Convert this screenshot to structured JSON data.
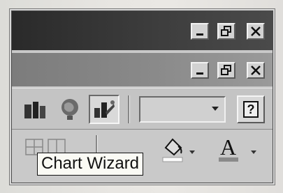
{
  "tooltip": {
    "text": "Chart Wizard"
  },
  "window_controls": {
    "outer": [
      "minimize-icon",
      "restore-icon",
      "close-icon"
    ],
    "inner": [
      "minimize-icon",
      "restore-icon",
      "close-icon"
    ]
  },
  "toolbar": {
    "buttons": [
      "chart-icon",
      "map-icon",
      "chart-wizard-icon",
      "zoom-combo",
      "help-icon"
    ],
    "zoom_value": "",
    "help_glyph": "?"
  },
  "format_toolbar": {
    "buttons": [
      "borders-icon",
      "fill-color-icon",
      "font-color-icon"
    ],
    "font_color_glyph": "A"
  },
  "colors": {
    "titlebar": "#333333",
    "inner_titlebar": "#8a8a8a",
    "tooltip_bg": "#fafaf4"
  }
}
